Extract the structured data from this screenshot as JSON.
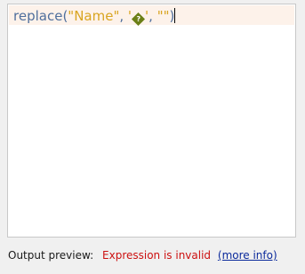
{
  "editor": {
    "tokens": {
      "fn": "replace",
      "open": "(",
      "arg1": "\"Name\"",
      "sep1": ", ",
      "quote_open": "'",
      "bad_char": "?",
      "quote_close": "'",
      "sep2": ", ",
      "arg3": "\"\"",
      "close": ")"
    }
  },
  "status": {
    "label": "Output preview:",
    "error": "Expression is invalid",
    "link": "(more info)"
  },
  "colors": {
    "function": "#4f6f9d",
    "string": "#d9a521",
    "invalid_char_bg": "#6b7f16",
    "error_text": "#cc1010",
    "link": "#0b2a9c",
    "line_highlight": "#fdf2ea"
  }
}
